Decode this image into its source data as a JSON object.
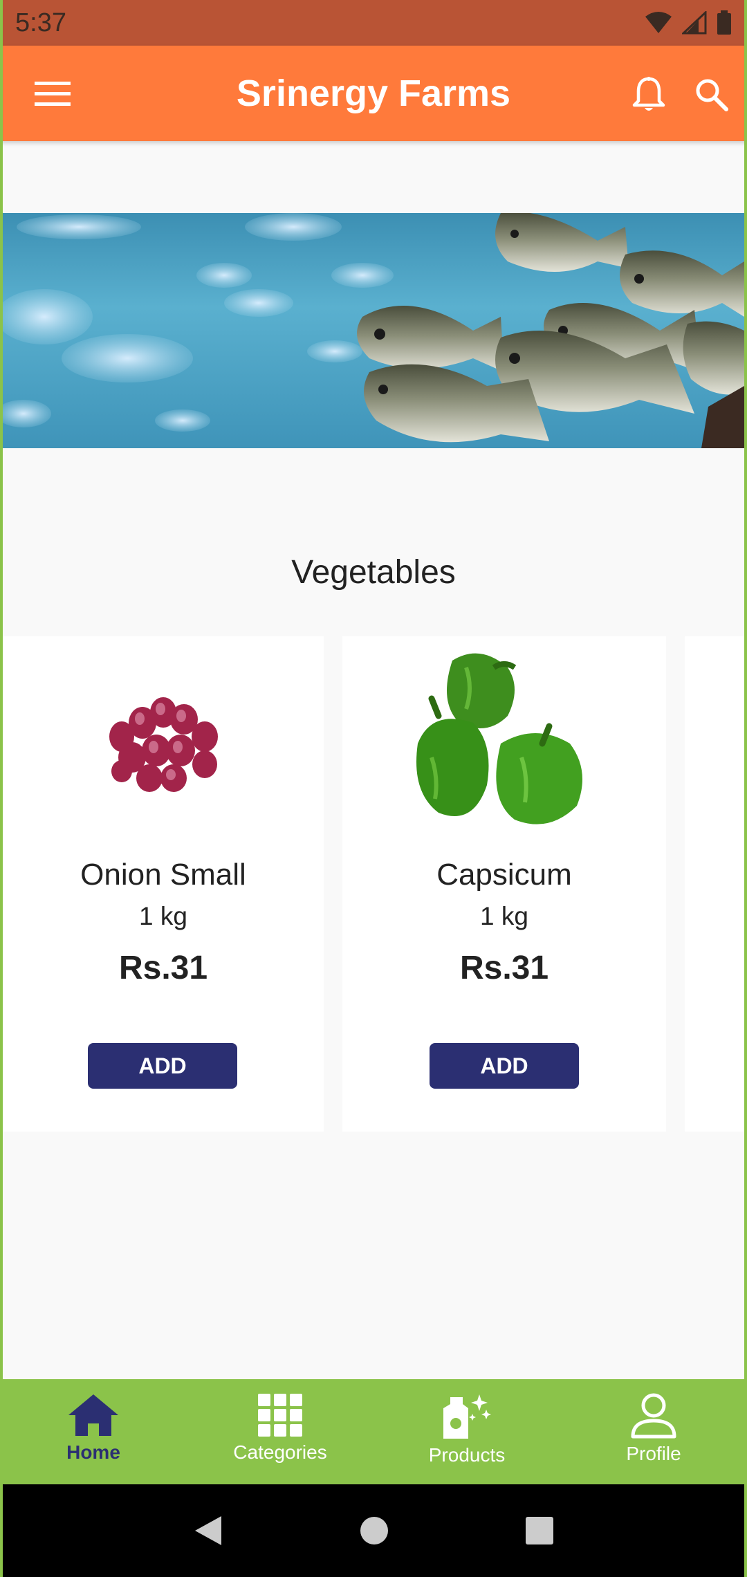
{
  "status_bar": {
    "time": "5:37"
  },
  "app_bar": {
    "title": "Srinergy Farms"
  },
  "section": {
    "title": "Vegetables"
  },
  "products": [
    {
      "name": "Onion Small",
      "qty": "1 kg",
      "price": "Rs.31",
      "add_label": "ADD"
    },
    {
      "name": "Capsicum",
      "qty": "1 kg",
      "price": "Rs.31",
      "add_label": "ADD"
    }
  ],
  "bottom_nav": {
    "items": [
      {
        "label": "Home",
        "icon": "home-icon",
        "active": true
      },
      {
        "label": "Categories",
        "icon": "grid-icon",
        "active": false
      },
      {
        "label": "Products",
        "icon": "products-icon",
        "active": false
      },
      {
        "label": "Profile",
        "icon": "person-icon",
        "active": false
      }
    ]
  },
  "colors": {
    "status_bar": "#b95435",
    "app_bar": "#ff7a3b",
    "accent_navy": "#2b2f72",
    "bottom_nav": "#8bc34a"
  }
}
